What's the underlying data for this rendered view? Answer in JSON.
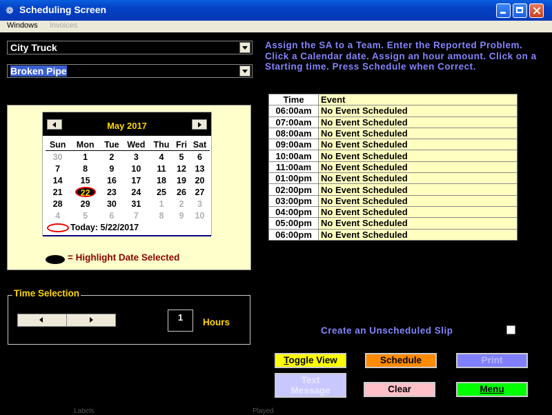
{
  "window": {
    "title": "Scheduling Screen"
  },
  "menu": {
    "windows": "Windows",
    "invoices": "Invoices"
  },
  "combos": {
    "truck": "City Truck",
    "problem": "Broken Pipe"
  },
  "instructions": "Assign the SA to a Team. Enter the Reported Problem. Click a Calendar date. Assign an hour amount. Click on a Starting time.  Press Schedule when Correct.",
  "calendar": {
    "month_label": "May 2017",
    "days_of_week": [
      "Sun",
      "Mon",
      "Tue",
      "Wed",
      "Thu",
      "Fri",
      "Sat"
    ],
    "weeks": [
      [
        "30",
        "1",
        "2",
        "3",
        "4",
        "5",
        "6"
      ],
      [
        "7",
        "8",
        "9",
        "10",
        "11",
        "12",
        "13"
      ],
      [
        "14",
        "15",
        "16",
        "17",
        "18",
        "19",
        "20"
      ],
      [
        "21",
        "22",
        "23",
        "24",
        "25",
        "26",
        "27"
      ],
      [
        "28",
        "29",
        "30",
        "31",
        "1",
        "2",
        "3"
      ],
      [
        "4",
        "5",
        "6",
        "7",
        "8",
        "9",
        "10"
      ]
    ],
    "selected": "22",
    "today_label": "Today: 5/22/2017"
  },
  "legend": {
    "text": "=  Highlight Date Selected"
  },
  "time_selection": {
    "title": "Time Selection",
    "hours_value": "1",
    "hours_label": "Hours"
  },
  "schedule": {
    "headers": [
      "Time",
      "Event"
    ],
    "rows": [
      [
        "06:00am",
        "No Event Scheduled"
      ],
      [
        "07:00am",
        "No Event Scheduled"
      ],
      [
        "08:00am",
        "No Event Scheduled"
      ],
      [
        "09:00am",
        "No Event Scheduled"
      ],
      [
        "10:00am",
        "No Event Scheduled"
      ],
      [
        "11:00am",
        "No Event Scheduled"
      ],
      [
        "01:00pm",
        "No Event Scheduled"
      ],
      [
        "02:00pm",
        "No Event Scheduled"
      ],
      [
        "03:00pm",
        "No Event Scheduled"
      ],
      [
        "04:00pm",
        "No Event Scheduled"
      ],
      [
        "05:00pm",
        "No Event Scheduled"
      ],
      [
        "06:00pm",
        "No Event Scheduled"
      ]
    ]
  },
  "unscheduled": {
    "label": "Create an Unscheduled Slip",
    "checked": false
  },
  "buttons": {
    "toggle_view_first": "T",
    "toggle_view_rest": "oggle View",
    "schedule": "Schedule",
    "print": "Print",
    "text_message_1": "Text",
    "text_message_2": "Message",
    "clear": "Clear",
    "menu": "Menu"
  },
  "footer": {
    "labels": "Labels",
    "played": "Played"
  },
  "colors": {
    "titlebar": "#0441c4",
    "instructions": "#8484ff",
    "panel": "#ffffcc",
    "toggle": "#ffff00",
    "schedule": "#ff8c00",
    "print": "#8080ff",
    "text_msg": "#c8c8ff",
    "clear": "#ffc0c8",
    "menu": "#00ff00"
  }
}
